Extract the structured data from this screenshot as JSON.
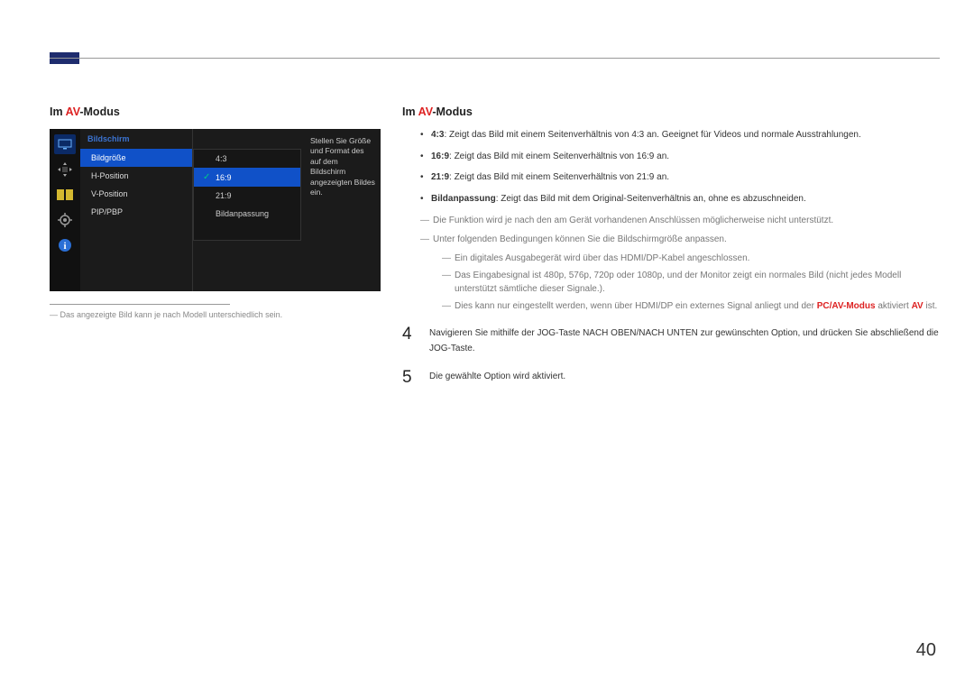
{
  "accentBar": true,
  "left": {
    "heading_pre": "Im ",
    "heading_em": "AV",
    "heading_post": "-Modus",
    "osd": {
      "header": "Bildschirm",
      "items": [
        {
          "label": "Bildgröße",
          "selected": true
        },
        {
          "label": "H-Position",
          "selected": false
        },
        {
          "label": "V-Position",
          "selected": false
        },
        {
          "label": "PIP/PBP",
          "selected": false
        }
      ],
      "subitems": [
        {
          "label": "4:3",
          "selected": false
        },
        {
          "label": "16:9",
          "selected": true
        },
        {
          "label": "21:9",
          "selected": false
        },
        {
          "label": "Bildanpassung",
          "selected": false
        }
      ],
      "help": "Stellen Sie Größe und Format des auf dem Bildschirm angezeigten Bildes ein."
    },
    "caption": "Das angezeigte Bild kann je nach Modell unterschiedlich sein."
  },
  "right": {
    "heading_pre": "Im ",
    "heading_em": "AV",
    "heading_post": "-Modus",
    "bullets": [
      {
        "bold": "4:3",
        "text": ": Zeigt das Bild mit einem Seitenverhältnis von 4:3 an. Geeignet für Videos und normale Ausstrahlungen."
      },
      {
        "bold": "16:9",
        "text": ": Zeigt das Bild mit einem Seitenverhältnis von 16:9 an."
      },
      {
        "bold": "21:9",
        "text": ": Zeigt das Bild mit einem Seitenverhältnis von 21:9 an."
      },
      {
        "bold": "Bildanpassung",
        "text": ": Zeigt das Bild mit dem Original-Seitenverhältnis an, ohne es abzuschneiden."
      }
    ],
    "note1": "Die Funktion wird je nach den am Gerät vorhandenen Anschlüssen möglicherweise nicht unterstützt.",
    "note2": "Unter folgenden Bedingungen können Sie die Bildschirmgröße anpassen.",
    "sub1": "Ein digitales Ausgabegerät wird über das HDMI/DP-Kabel angeschlossen.",
    "sub2": "Das Eingabesignal ist 480p, 576p, 720p oder 1080p, und der Monitor zeigt ein normales Bild (nicht jedes Modell unterstützt sämtliche dieser Signale.).",
    "sub3_a": "Dies kann nur eingestellt werden, wenn über HDMI/DP ein externes Signal anliegt und der ",
    "sub3_b": "PC/AV-Modus",
    "sub3_c": " aktiviert ",
    "sub3_d": "AV",
    "sub3_e": " ist.",
    "step4_num": "4",
    "step4_text": "Navigieren Sie mithilfe der JOG-Taste NACH OBEN/NACH UNTEN zur gewünschten Option, und drücken Sie abschließend die JOG-Taste.",
    "step5_num": "5",
    "step5_text": "Die gewählte Option wird aktiviert."
  },
  "pageNumber": "40"
}
